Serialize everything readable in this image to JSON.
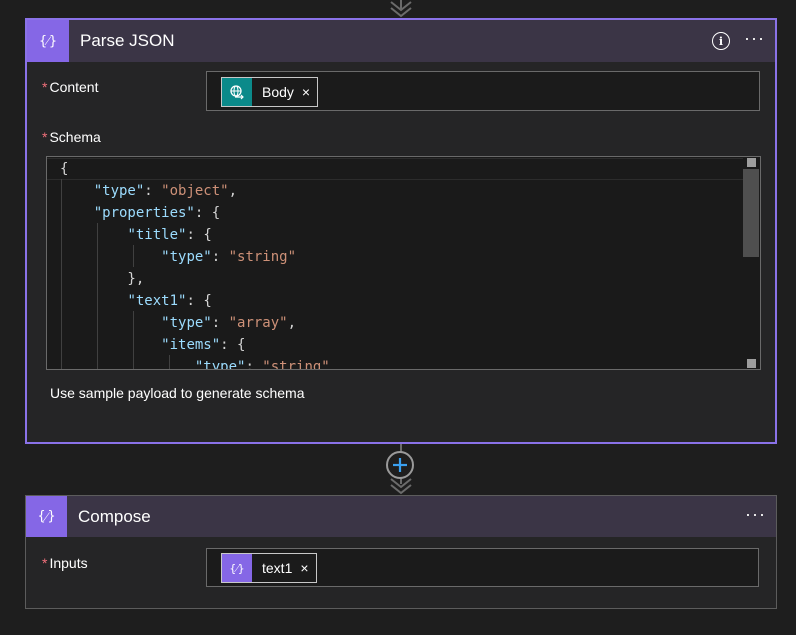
{
  "parse_json": {
    "title": "Parse JSON",
    "icon": "expression-icon",
    "content_label": "Content",
    "content_token": "Body",
    "schema_label": "Schema",
    "sample_link": "Use sample payload to generate schema",
    "schema_lines": [
      "{",
      "    \"type\": \"object\",",
      "    \"properties\": {",
      "        \"title\": {",
      "            \"type\": \"string\"",
      "        },",
      "        \"text1\": {",
      "            \"type\": \"array\",",
      "            \"items\": {",
      "                \"type\": \"string\""
    ]
  },
  "compose": {
    "title": "Compose",
    "icon": "expression-icon",
    "inputs_label": "Inputs",
    "inputs_token": "text1"
  },
  "labels": {
    "required": "*",
    "token_remove": "×",
    "more": "···",
    "info": "i"
  },
  "colors": {
    "accent_purple": "#8567e6",
    "selected_border": "#8a72e8",
    "token_teal": "#0b8a8a",
    "header_bg": "#3b3546",
    "required_red": "#f1707b",
    "add_blue": "#3aa0f0"
  }
}
